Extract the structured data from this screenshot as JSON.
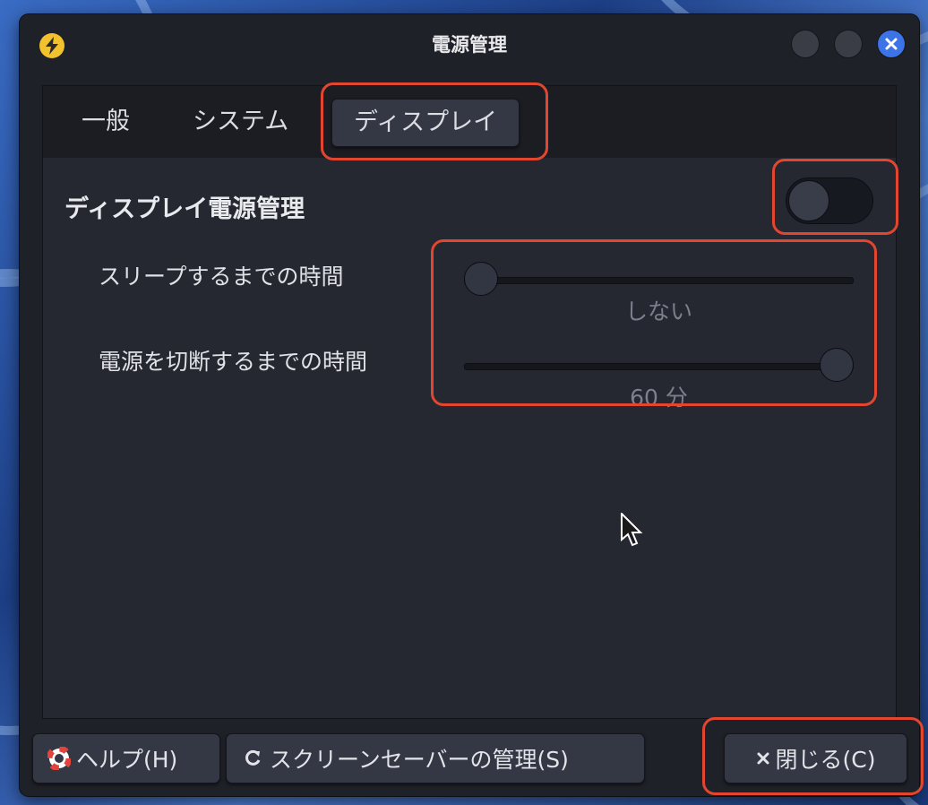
{
  "window": {
    "title": "電源管理"
  },
  "tabs": [
    {
      "label": "一般",
      "active": false
    },
    {
      "label": "システム",
      "active": false
    },
    {
      "label": "ディスプレイ",
      "active": true
    }
  ],
  "display": {
    "section_label": "ディスプレイ電源管理",
    "power_management_enabled": false,
    "sleep": {
      "label": "スリープするまでの時間",
      "value_text": "しない",
      "slider_fraction": 0.0
    },
    "off": {
      "label": "電源を切断するまでの時間",
      "value_text": "60 分",
      "slider_fraction": 1.0
    }
  },
  "buttons": {
    "help": "ヘルプ(H)",
    "screensaver": "スクリーンセーバーの管理(S)",
    "close": "閉じる(C)"
  },
  "icons": {
    "app": "lightning-bolt-icon",
    "help": "lifebuoy-icon",
    "screensaver": "refresh-icon",
    "close": "x-icon"
  },
  "colors": {
    "annotation": "#e2462f",
    "window_bg": "#1f2128",
    "close_button": "#3c74e8",
    "app_icon": "#f2c12e"
  }
}
